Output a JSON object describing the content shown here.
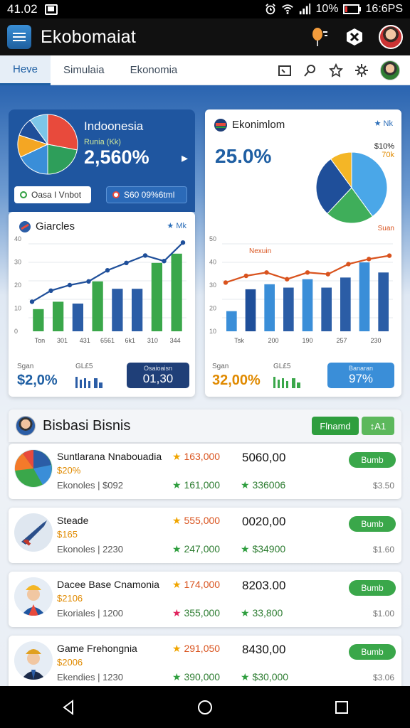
{
  "status": {
    "time": "41.02",
    "battery": "10%",
    "clock": "16:6PS"
  },
  "app": {
    "title": "Ekobomaiat"
  },
  "tabs": [
    {
      "label": "Heve",
      "active": true
    },
    {
      "label": "Simulaia",
      "active": false
    },
    {
      "label": "Ekonomia",
      "active": false
    }
  ],
  "indonesia": {
    "title": "Indoonesia",
    "sub": "Runia (Kk)",
    "value": "2,560%",
    "btn_light": "Oasa I Vnbot",
    "btn_dark": "S60 09%6tml",
    "pie": [
      {
        "v": 28,
        "c": "#e84a3c"
      },
      {
        "v": 22,
        "c": "#2e9e5a"
      },
      {
        "v": 18,
        "c": "#3a8ed8"
      },
      {
        "v": 12,
        "c": "#f4a623"
      },
      {
        "v": 10,
        "c": "#1f4f9a"
      },
      {
        "v": 10,
        "c": "#7cc6e8"
      }
    ]
  },
  "chart_left": {
    "title": "Giarcles",
    "tag": "Mk",
    "stat_label_1": "Sgan",
    "stat_value_1": "$2,0%",
    "stat_label_2": "GL£5",
    "stat_box_label": "Osaioaisn",
    "stat_box_value": "01,30"
  },
  "chart_right": {
    "title": "Ekonimlom",
    "tag": "Nk",
    "big": "25.0%",
    "pie_label_1": "$10%",
    "pie_label_2": "70k",
    "line_label": "Nexuin",
    "line_label_2": "Suan",
    "stat_label_1": "Sgan",
    "stat_value_1": "32,00%",
    "stat_label_2": "GL£5",
    "stat_box_label": "Banaran",
    "stat_box_value": "97%",
    "pie": [
      {
        "v": 40,
        "c": "#4aa7e8"
      },
      {
        "v": 22,
        "c": "#3fae5a"
      },
      {
        "v": 28,
        "c": "#1f4f9a"
      },
      {
        "v": 10,
        "c": "#f4b626"
      }
    ]
  },
  "chart_data": [
    {
      "type": "bar",
      "title": "Giarcles",
      "categories": [
        "Ton",
        "301",
        "431",
        "6561",
        "6k1",
        "310",
        "344"
      ],
      "yticks": [
        "0",
        "10",
        "20",
        "30",
        "40"
      ],
      "ylim": [
        0,
        50
      ],
      "series": [
        {
          "values": [
            12,
            16,
            15,
            27,
            23,
            23,
            37,
            42
          ],
          "colors": [
            "#3aa74a",
            "#3aa74a",
            "#2b5da6",
            "#3aa74a",
            "#2b5da6",
            "#2b5da6",
            "#3aa74a",
            "#3aa74a"
          ]
        }
      ],
      "line": [
        16,
        22,
        25,
        27,
        33,
        37,
        41,
        38,
        48
      ]
    },
    {
      "type": "bar",
      "title": "Ekonimlom",
      "categories": [
        "Tsk",
        "200",
        "190",
        "257",
        "230"
      ],
      "yticks": [
        "10",
        "20",
        "30",
        "40",
        "50"
      ],
      "ylim": [
        0,
        55
      ],
      "series": [
        {
          "values": [
            12,
            25,
            28,
            26,
            31,
            26,
            32,
            41,
            35
          ],
          "colors": [
            "#3a8ed8",
            "#1f4f9a",
            "#3a8ed8",
            "#2b5da6",
            "#3a8ed8",
            "#2b5da6",
            "#2b5da6",
            "#3a8ed8",
            "#2b5da6"
          ]
        }
      ],
      "line": [
        29,
        33,
        35,
        31,
        35,
        34,
        40,
        43,
        45
      ]
    }
  ],
  "bisnis": {
    "title": "Bisbasi Bisnis",
    "btn_1": "Flnamd",
    "btn_2": "A1",
    "items": [
      {
        "name": "Suntlarana Nnabouadia",
        "price": "$20%",
        "meta": "Ekonoles | $092",
        "star1": "163,000",
        "star2": "161,000",
        "amount": "5060,00",
        "amount2": "336006",
        "button": "Bumb",
        "small": "$3.50",
        "star1_color": "#f0a500",
        "star2_color": "#2e9e3e",
        "star3_color": "#2e9e3e"
      },
      {
        "name": "Steade",
        "price": "$165",
        "meta": "Ekonoles | 2230",
        "star1": "555,000",
        "star2": "247,000",
        "amount": "0020,00",
        "amount2": "$34900",
        "button": "Bumb",
        "small": "$1.60",
        "star1_color": "#f0a500",
        "star2_color": "#2e9e3e",
        "star3_color": "#2e9e3e"
      },
      {
        "name": "Dacee Base Cnamonia",
        "price": "$2106",
        "meta": "Ekoriales | 1200",
        "star1": "174,000",
        "star2": "355,000",
        "amount": "8203.00",
        "amount2": "33,800",
        "button": "Bumb",
        "small": "$1.00",
        "star1_color": "#f0a500",
        "star2_color": "#e0245e",
        "star3_color": "#2e9e3e"
      },
      {
        "name": "Game Frehongnia",
        "price": "$2006",
        "meta": "Ekendies | 1230",
        "star1": "291,050",
        "star2": "390,000",
        "amount": "8430,00",
        "amount2": "$30,000",
        "button": "Bumb",
        "small": "$3.06",
        "star1_color": "#f0a500",
        "star2_color": "#2e9e3e",
        "star3_color": "#2e9e3e"
      }
    ]
  }
}
